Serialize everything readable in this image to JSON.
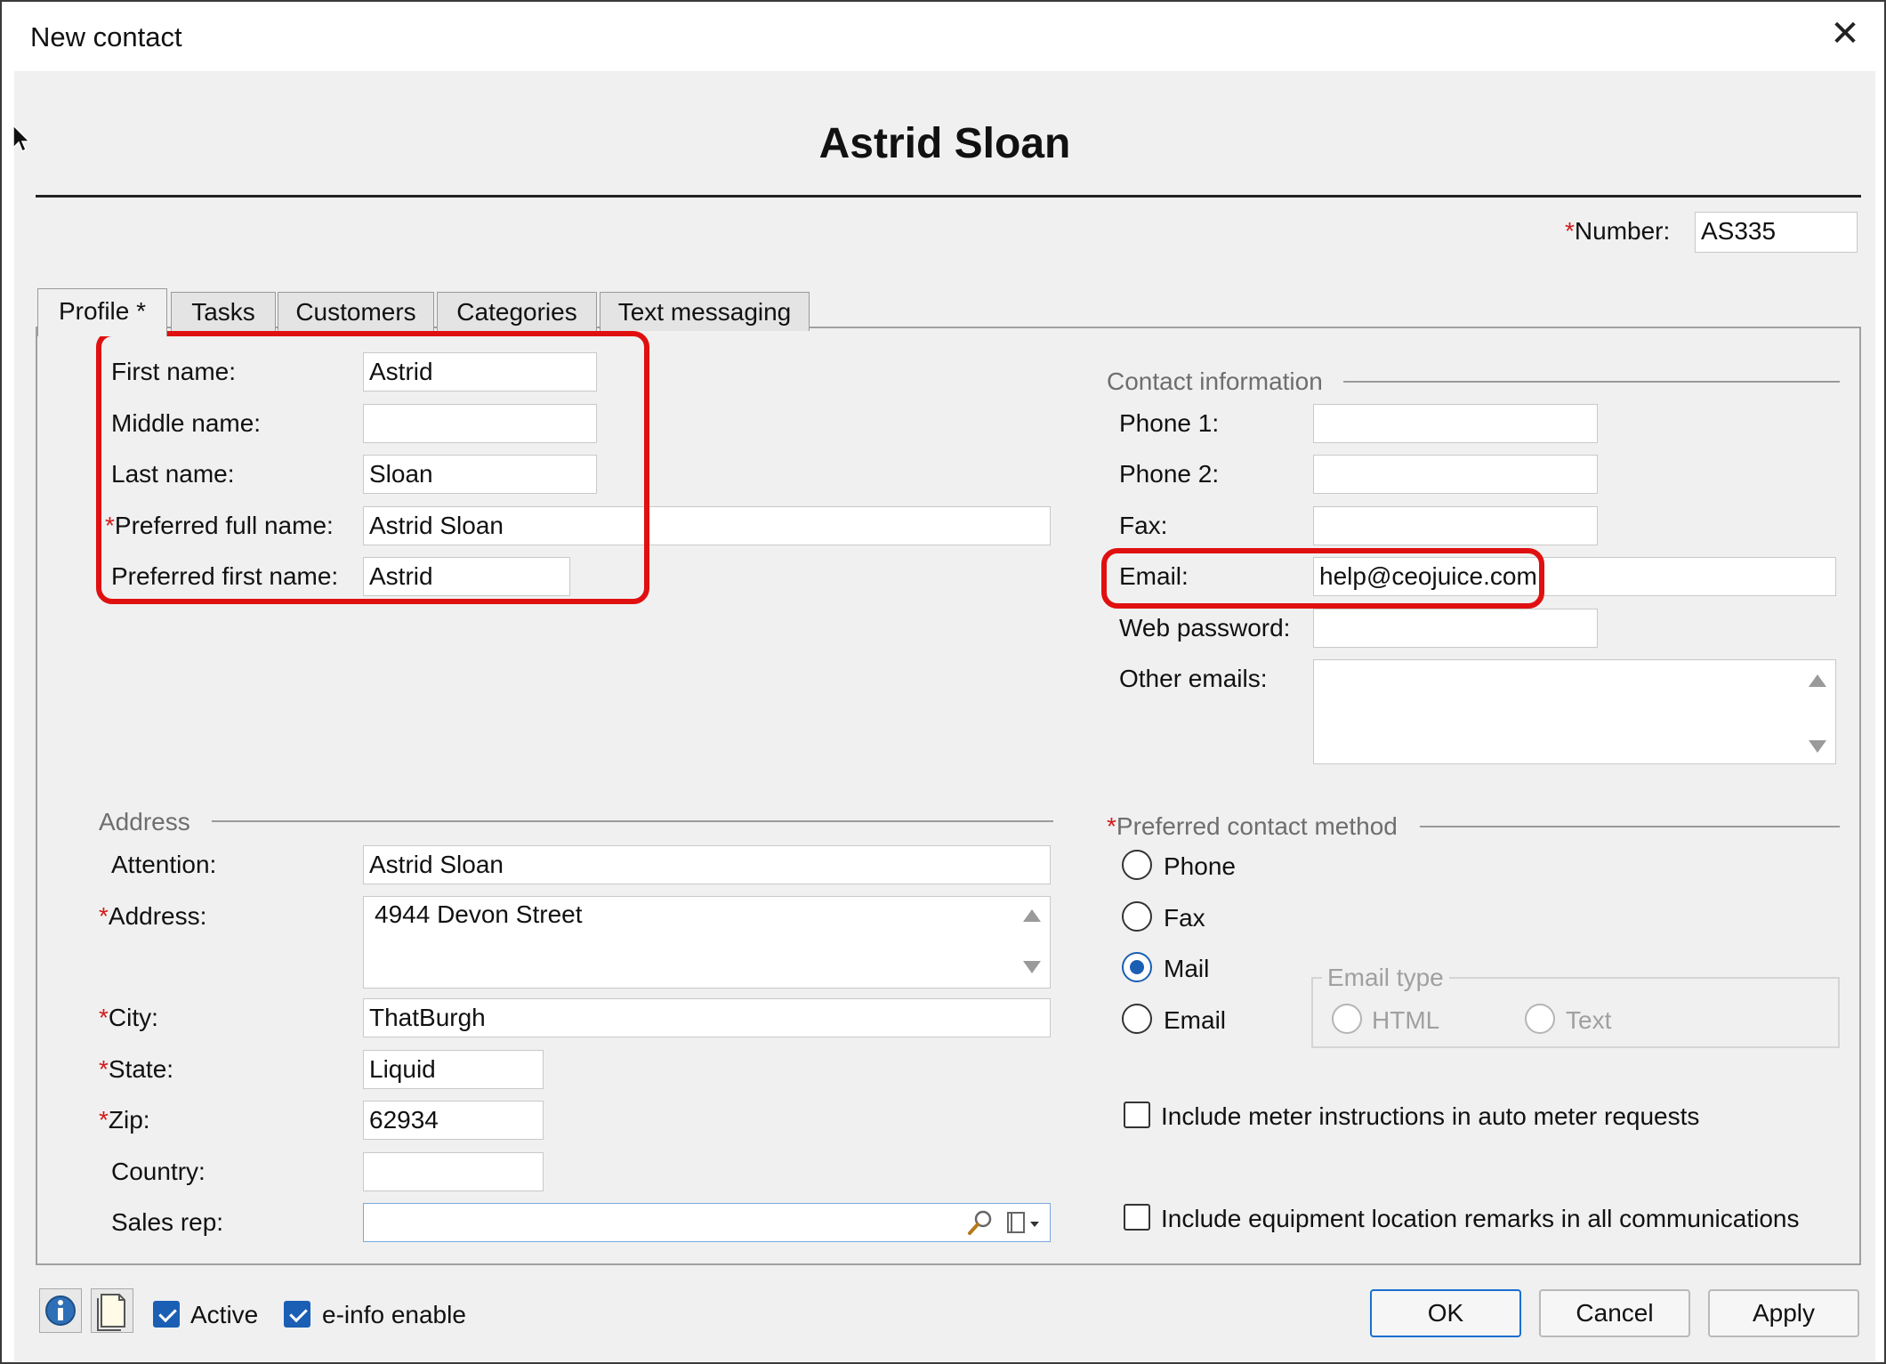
{
  "window": {
    "title": "New contact",
    "close_glyph": "✕"
  },
  "heading": "Astrid Sloan",
  "number": {
    "label": "Number:",
    "required_mark": "*",
    "value": "AS335"
  },
  "tabs": [
    {
      "label": "Profile *",
      "active": true
    },
    {
      "label": "Tasks",
      "active": false
    },
    {
      "label": "Customers",
      "active": false
    },
    {
      "label": "Categories",
      "active": false
    },
    {
      "label": "Text messaging",
      "active": false
    }
  ],
  "name": {
    "first": {
      "label": "First name:",
      "value": "Astrid"
    },
    "middle": {
      "label": "Middle name:",
      "value": ""
    },
    "last": {
      "label": "Last name:",
      "value": "Sloan"
    },
    "preferred_full": {
      "label": "Preferred full name:",
      "required_mark": "*",
      "value": "Astrid Sloan"
    },
    "preferred_first": {
      "label": "Preferred first name:",
      "value": "Astrid"
    }
  },
  "contact": {
    "group_title": "Contact information",
    "phone1": {
      "label": "Phone 1:",
      "value": ""
    },
    "phone2": {
      "label": "Phone 2:",
      "value": ""
    },
    "fax": {
      "label": "Fax:",
      "value": ""
    },
    "email": {
      "label": "Email:",
      "value": "help@ceojuice.com"
    },
    "web_password": {
      "label": "Web password:",
      "value": ""
    },
    "other_emails": {
      "label": "Other emails:",
      "value": ""
    }
  },
  "address": {
    "group_title": "Address",
    "attention": {
      "label": "Attention:",
      "value": "Astrid Sloan"
    },
    "address": {
      "label": "Address:",
      "required_mark": "*",
      "value": "4944 Devon Street"
    },
    "city": {
      "label": "City:",
      "required_mark": "*",
      "value": "ThatBurgh"
    },
    "state": {
      "label": "State:",
      "required_mark": "*",
      "value": "Liquid"
    },
    "zip": {
      "label": "Zip:",
      "required_mark": "*",
      "value": "62934"
    },
    "country": {
      "label": "Country:",
      "value": ""
    },
    "sales_rep": {
      "label": "Sales rep:",
      "value": ""
    }
  },
  "preferred_contact": {
    "group_title": "Preferred contact method",
    "required_mark": "*",
    "options": [
      "Phone",
      "Fax",
      "Mail",
      "Email"
    ],
    "selected": "Mail",
    "email_type": {
      "title": "Email type",
      "options": [
        "HTML",
        "Text"
      ],
      "enabled": false
    }
  },
  "options": {
    "meter_instructions": {
      "label": "Include meter instructions in auto meter requests",
      "checked": false
    },
    "location_remarks": {
      "label": "Include equipment location remarks in all communications",
      "checked": false
    }
  },
  "footer": {
    "active": {
      "label": "Active",
      "checked": true
    },
    "einfo": {
      "label": "e-info enable",
      "checked": true
    },
    "ok": "OK",
    "cancel": "Cancel",
    "apply": "Apply"
  },
  "colors": {
    "highlight": "#e01010",
    "accent": "#1a5fb4",
    "required": "#d21a1a"
  },
  "icons": {
    "info": "info-icon",
    "notes": "notes-icon",
    "search": "magnifier-icon",
    "lookup": "lookup-dropdown-icon"
  }
}
